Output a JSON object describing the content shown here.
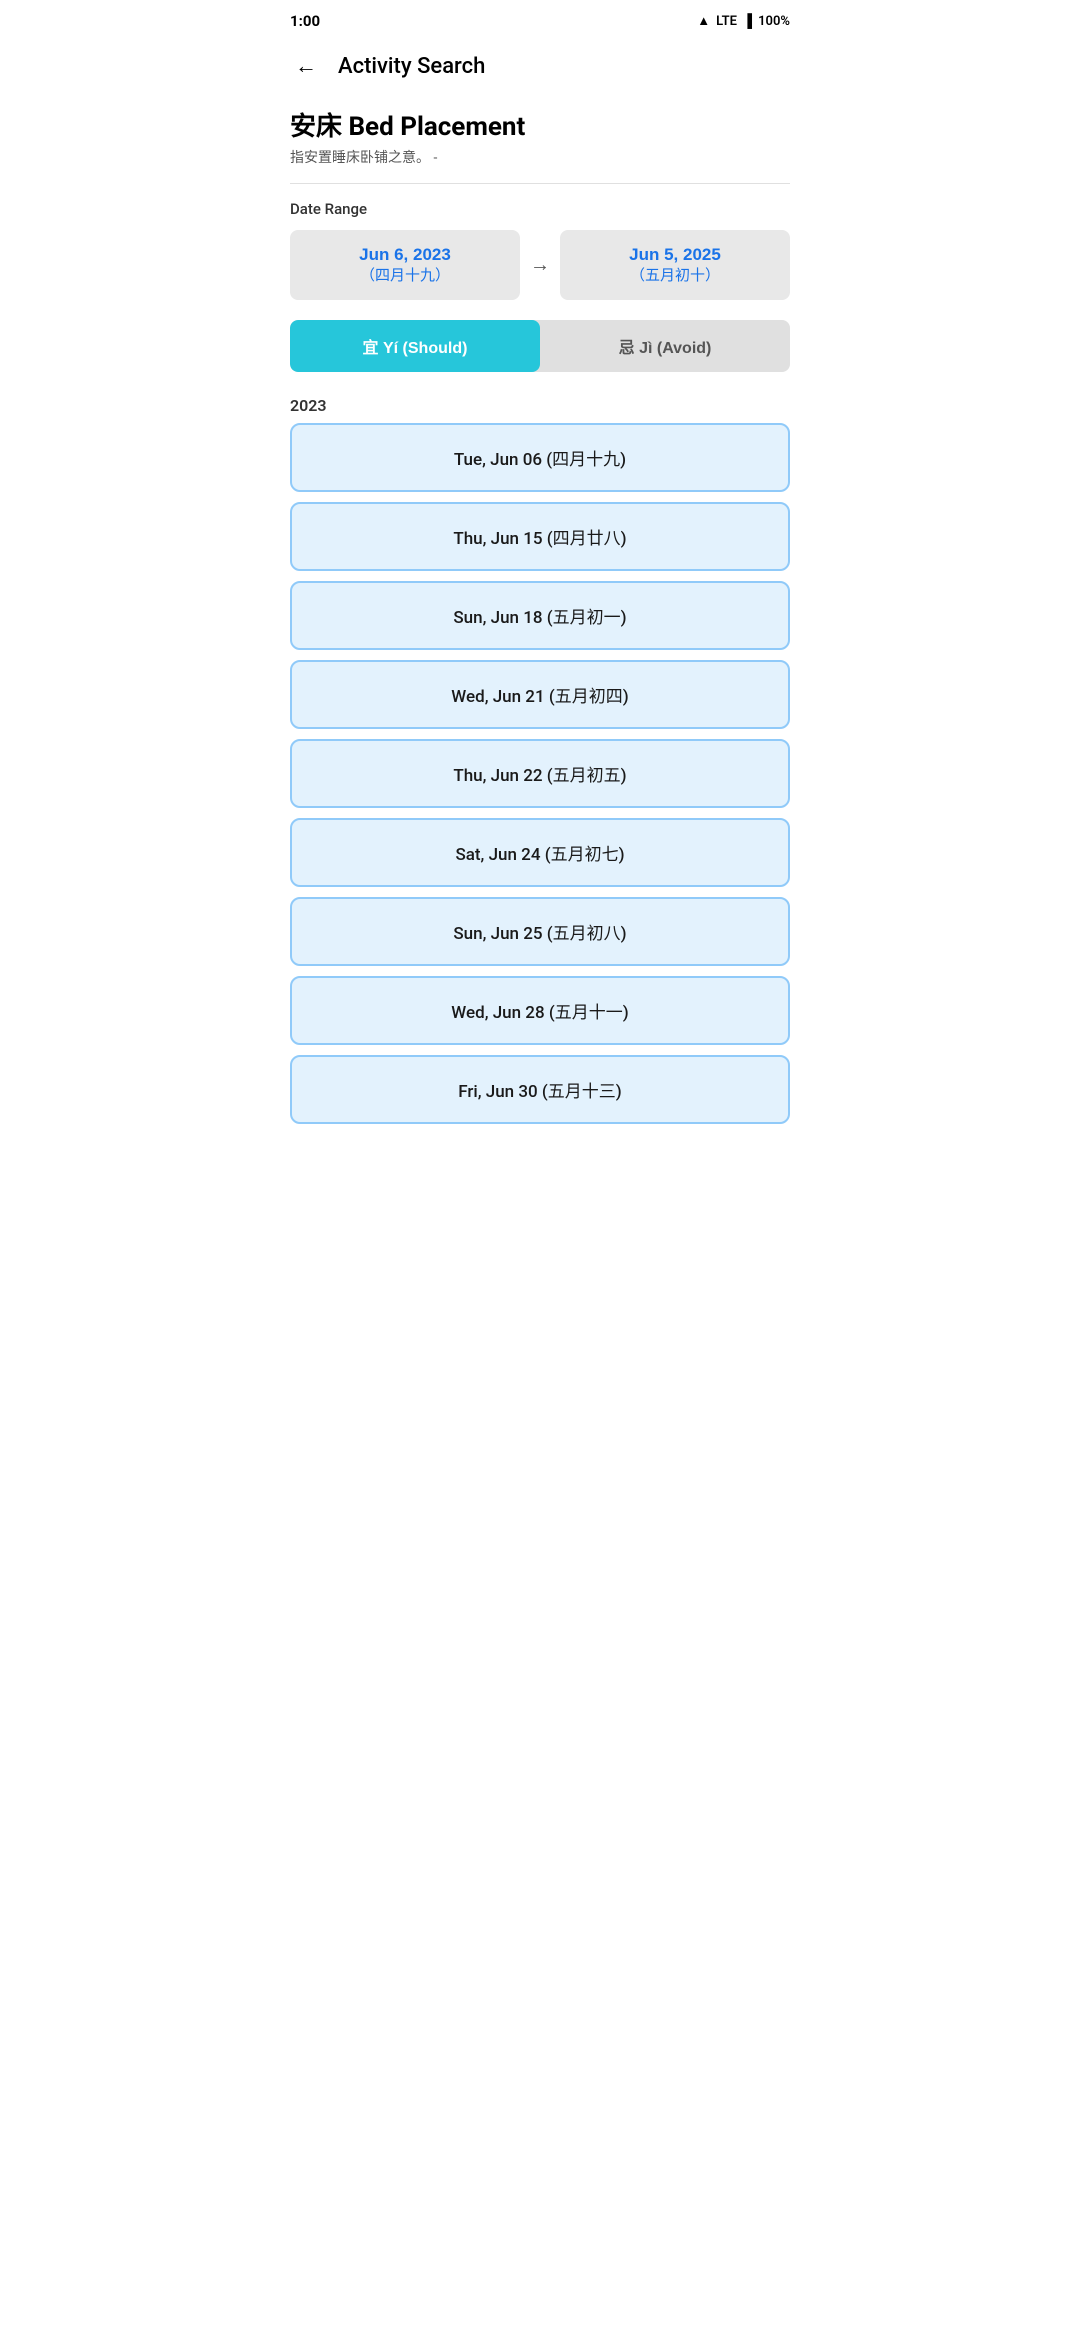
{
  "statusBar": {
    "time": "1:00",
    "icons": "▲ LTE ▐ 100%"
  },
  "nav": {
    "backLabel": "←",
    "pageTitle": "Activity Search"
  },
  "activity": {
    "name": "安床 Bed Placement",
    "description": "指安置睡床卧铺之意。 -"
  },
  "dateRange": {
    "label": "Date Range",
    "startMain": "Jun 6, 2023",
    "startSub": "（四月十九）",
    "endMain": "Jun 5, 2025",
    "endSub": "（五月初十）",
    "arrowSymbol": "→"
  },
  "toggle": {
    "option1": "宜 Yí (Should)",
    "option2": "忌 Jì (Avoid)",
    "activeIndex": 0
  },
  "yearLabel": "2023",
  "dates": [
    "Tue, Jun 06 (四月十九)",
    "Thu, Jun 15 (四月廿八)",
    "Sun, Jun 18 (五月初一)",
    "Wed, Jun 21 (五月初四)",
    "Thu, Jun 22 (五月初五)",
    "Sat, Jun 24 (五月初七)",
    "Sun, Jun 25 (五月初八)",
    "Wed, Jun 28 (五月十一)",
    "Fri, Jun 30 (五月十三)"
  ]
}
